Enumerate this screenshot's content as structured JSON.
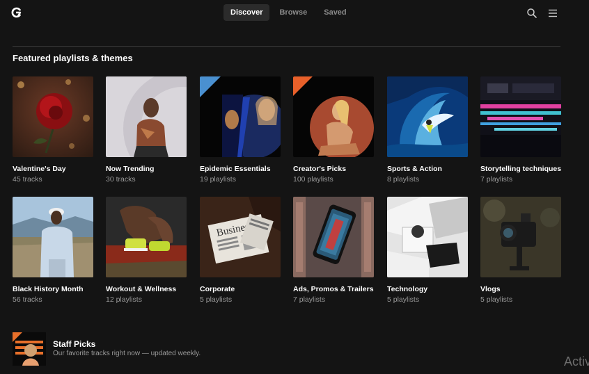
{
  "nav": {
    "tabs": [
      {
        "label": "Discover"
      },
      {
        "label": "Browse"
      },
      {
        "label": "Saved"
      }
    ]
  },
  "section": {
    "title": "Featured playlists & themes"
  },
  "rows": [
    [
      {
        "title": "Valentine's Day",
        "sub": "45 tracks"
      },
      {
        "title": "Now Trending",
        "sub": "30 tracks"
      },
      {
        "title": "Epidemic Essentials",
        "sub": "19 playlists"
      },
      {
        "title": "Creator's Picks",
        "sub": "100 playlists"
      },
      {
        "title": "Sports & Action",
        "sub": "8 playlists"
      },
      {
        "title": "Storytelling techniques",
        "sub": "7 playlists"
      }
    ],
    [
      {
        "title": "Black History Month",
        "sub": "56 tracks"
      },
      {
        "title": "Workout & Wellness",
        "sub": "12 playlists"
      },
      {
        "title": "Corporate",
        "sub": "5 playlists"
      },
      {
        "title": "Ads, Promos & Trailers",
        "sub": "7 playlists"
      },
      {
        "title": "Technology",
        "sub": "5 playlists"
      },
      {
        "title": "Vlogs",
        "sub": "5 playlists"
      }
    ]
  ],
  "staff": {
    "title": "Staff Picks",
    "subtitle": "Our favorite tracks right now — updated weekly."
  },
  "thumb_text": {
    "corporate_newspaper": "Business"
  },
  "watermark": {
    "text": "Activ"
  },
  "icons": {
    "logo": "brand-logo-icon",
    "search": "search-icon",
    "menu": "menu-icon"
  },
  "colors": {
    "background": "#141414",
    "active_tab": "#2b2b2b",
    "muted_text": "#9a9a9a"
  }
}
